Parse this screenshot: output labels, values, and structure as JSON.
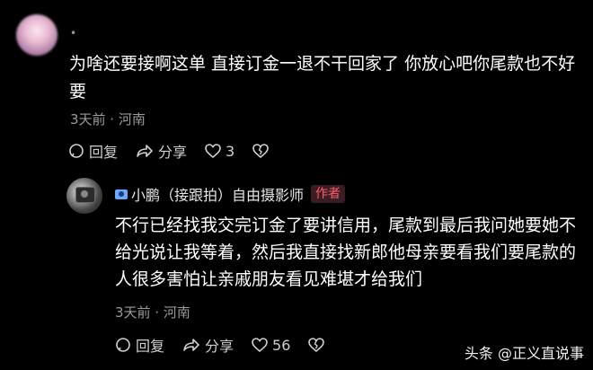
{
  "comment1": {
    "username": "•",
    "text": "为啥还要接啊这单 直接订金一退不干回家了 你放心吧你尾款也不好要",
    "time_location": "3天前 · 河南",
    "reply_label": "回复",
    "share_label": "分享",
    "like_count": "3"
  },
  "comment2": {
    "username": "小鹏（接跟拍）自由摄影师",
    "author_badge": "作者",
    "text": "不行已经找我交完订金了要讲信用，尾款到最后我问她要她不给光说让我等着，然后我直接找新郎他母亲要看我们要尾款的人很多害怕让亲戚朋友看见难堪才给我们",
    "time_location": "3天前 · 河南",
    "reply_label": "回复",
    "share_label": "分享",
    "like_count": "56"
  },
  "watermark": "头条 @正义直说事",
  "colors": {
    "background": "#000000",
    "badge_text": "#ff5b6e",
    "secondary_text": "#9a9a9a"
  }
}
